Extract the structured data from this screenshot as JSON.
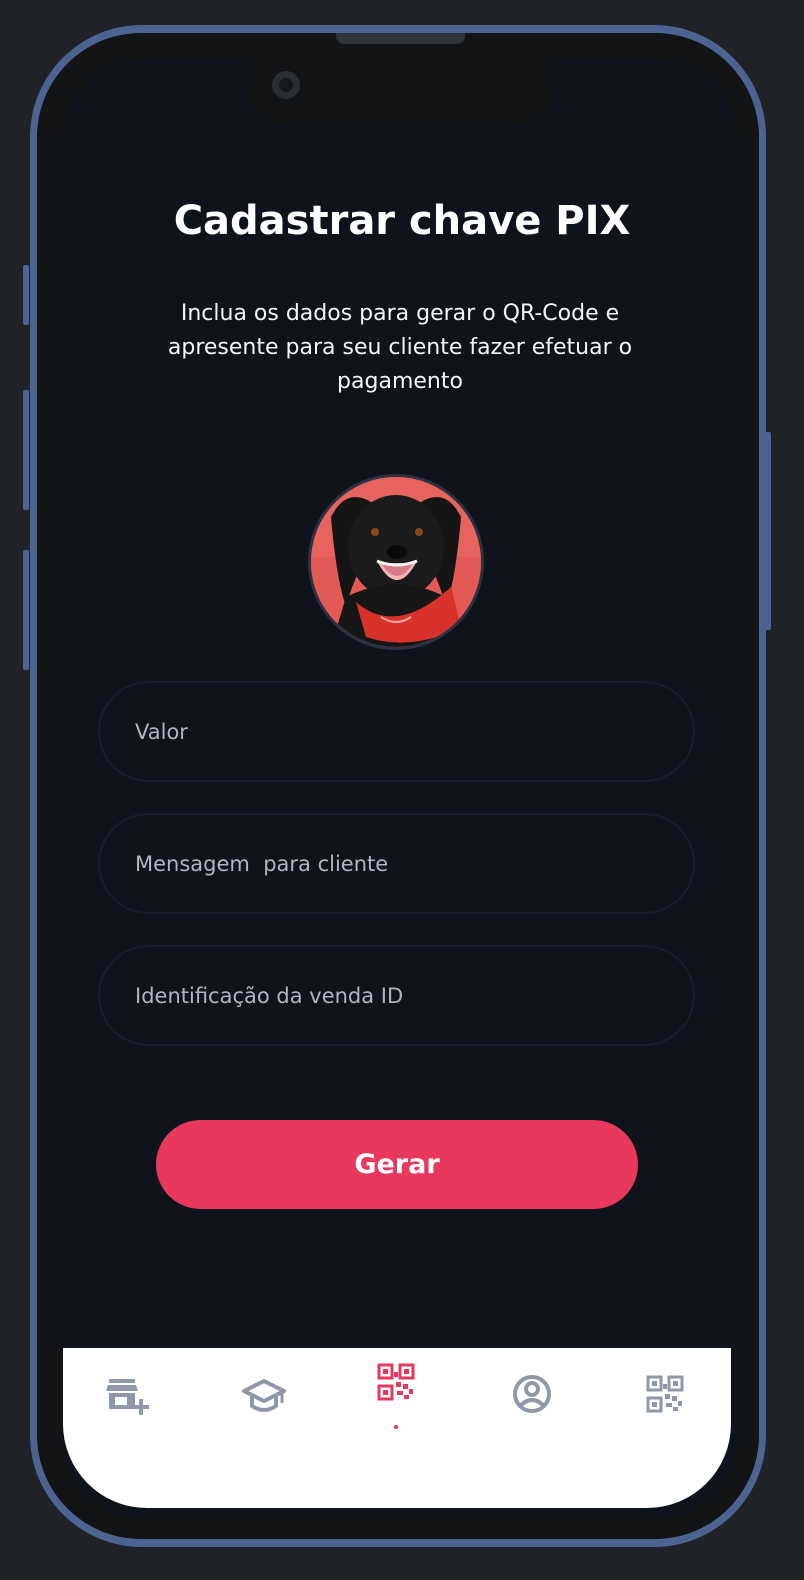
{
  "screen": {
    "title": "Cadastrar  chave PIX",
    "subtitle": "Inclua os dados para gerar o QR-Code e apresente para seu cliente fazer efetuar o pagamento"
  },
  "avatar": {
    "description_icon": "dog-avatar"
  },
  "form": {
    "valor_placeholder": "Valor",
    "mensagem_placeholder": "Mensagem  para cliente",
    "identificacao_placeholder": "Identificação da venda ID"
  },
  "actions": {
    "gerar_label": "Gerar"
  },
  "tabbar": {
    "items": [
      {
        "icon": "add-store-icon",
        "active": false
      },
      {
        "icon": "graduation-cap-icon",
        "active": false
      },
      {
        "icon": "qr-code-icon",
        "active": true
      },
      {
        "icon": "user-circle-icon",
        "active": false
      },
      {
        "icon": "qr-scan-icon",
        "active": false
      }
    ]
  },
  "colors": {
    "background": "#0f131c",
    "accent": "#e8385e",
    "frame": "#4d6492",
    "icon_inactive": "#8f98a8"
  }
}
